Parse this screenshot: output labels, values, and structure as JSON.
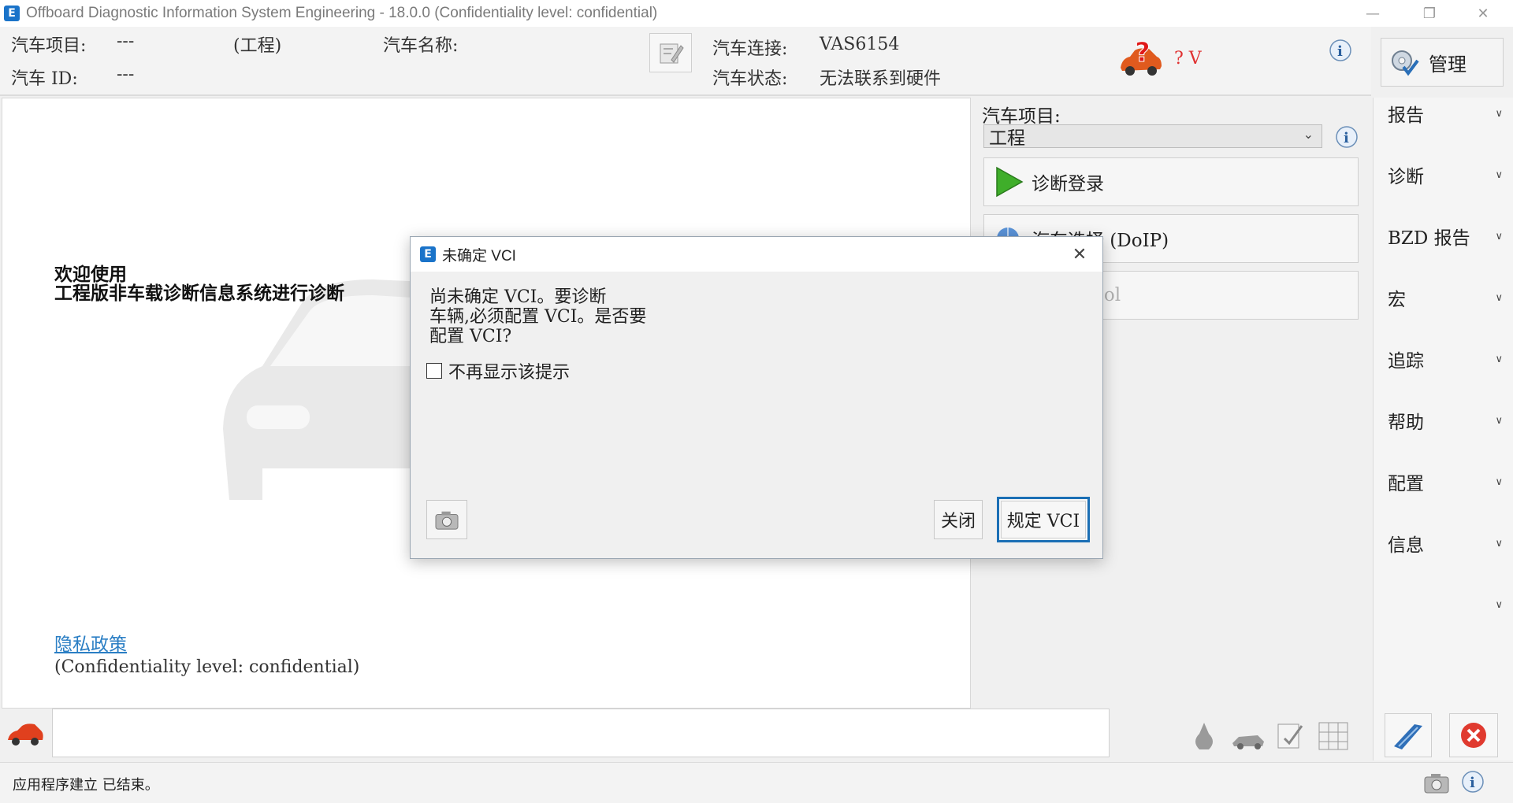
{
  "window": {
    "title": "Offboard Diagnostic Information System Engineering - 18.0.0 (Confidentiality level: confidential)",
    "app_icon_glyph": "E",
    "icon": "app-logo-icon"
  },
  "header": {
    "project_label": "汽车项目:",
    "project_value": "---",
    "project_type": "(工程)",
    "name_label": "汽车名称:",
    "name_value": "",
    "id_label": "汽车 ID:",
    "id_value": "---",
    "connection_label": "汽车连接:",
    "connection_value": "VAS6154",
    "status_label": "汽车状态:",
    "status_value": "无法联系到硬件",
    "hv_value": "? V",
    "manage_label": "管理"
  },
  "main": {
    "welcome_line1": "欢迎使用",
    "welcome_line2": "工程版非车载诊断信息系统进行诊断",
    "privacy_link": "隐私政策",
    "confidentiality": "(Confidentiality level: confidential)"
  },
  "right_panel": {
    "project_label": "汽车项目:",
    "project_select": "工程",
    "buttons": [
      {
        "label": "诊断登录",
        "icon": "play-icon"
      },
      {
        "label": "汽车选择 (DoIP)",
        "icon": "vehicle-globe-icon"
      },
      {
        "label": "Scan Tool",
        "icon": "scan-tool-icon"
      }
    ]
  },
  "sidebar": {
    "items": [
      {
        "label": "报告"
      },
      {
        "label": "诊断"
      },
      {
        "label": "BZD 报告"
      },
      {
        "label": "宏"
      },
      {
        "label": "追踪"
      },
      {
        "label": "帮助"
      },
      {
        "label": "配置"
      },
      {
        "label": "信息"
      },
      {
        "label": ""
      }
    ]
  },
  "dialog": {
    "title": "未确定 VCI",
    "message_line1": "尚未确定 VCI。要诊断",
    "message_line2": "车辆,必须配置 VCI。是否要",
    "message_line3": "配置 VCI?",
    "checkbox_label": "不再显示该提示",
    "checkbox_checked": false,
    "close_button": "关闭",
    "configure_button": "规定 VCI",
    "close_glyph": "✕"
  },
  "statusbar": {
    "text": "应用程序建立 已结束。"
  },
  "colors": {
    "accent_blue": "#1b6fb5",
    "link_blue": "#2a7ec4",
    "play_green": "#3fae2a",
    "exit_red": "#e03a2f"
  }
}
